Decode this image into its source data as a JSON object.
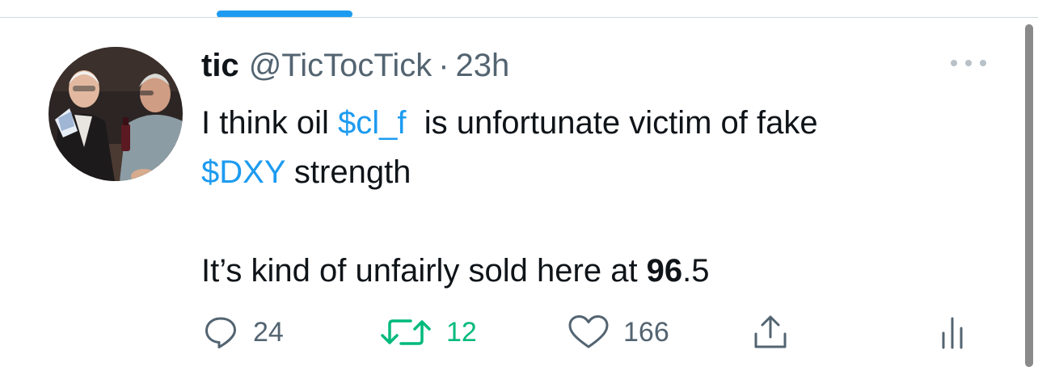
{
  "colors": {
    "accent": "#1d9bf0",
    "retweet_active": "#00ba7c",
    "muted": "#536471",
    "text": "#0f1419"
  },
  "tweet": {
    "display_name": "tic",
    "handle": "@TicTocTick",
    "separator": "·",
    "time": "23h",
    "text": {
      "line1_a": "I think oil ",
      "cashtag1": "$cl_f",
      "line1_b": "  is unfortunate victim of fake",
      "cashtag2": "$DXY",
      "line2_b": " strength",
      "line4_a": "It’s kind of unfairly sold here at ",
      "line4_bold": "96",
      "line4_b": ".5"
    },
    "icons": {
      "reply": "reply-icon",
      "retweet": "retweet-icon",
      "like": "heart-icon",
      "share": "share-icon",
      "analytics": "analytics-icon",
      "more": "more-icon"
    },
    "reply_count": "24",
    "retweet_count": "12",
    "like_count": "166"
  }
}
